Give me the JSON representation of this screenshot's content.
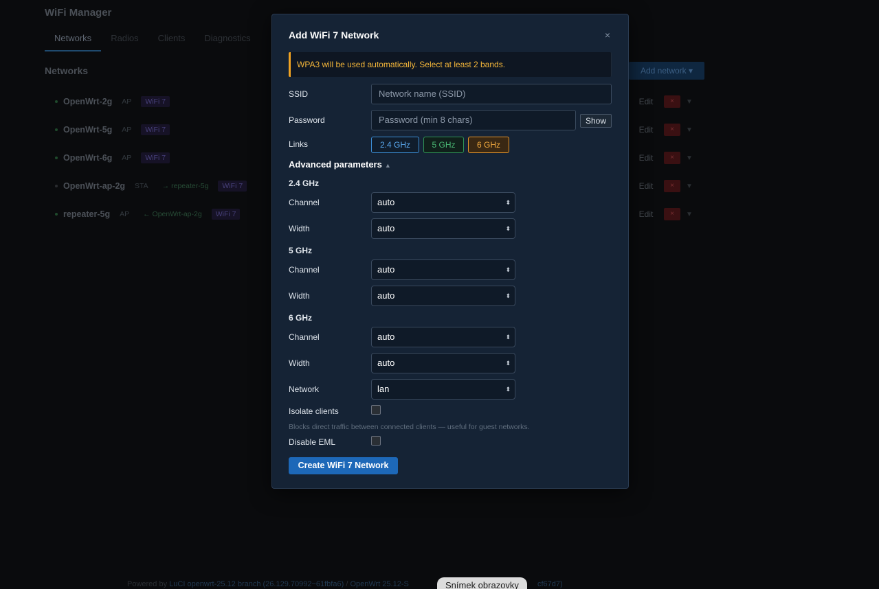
{
  "app": {
    "title": "WiFi Manager",
    "tabs": [
      {
        "label": "Networks"
      },
      {
        "label": "Radios"
      },
      {
        "label": "Clients"
      },
      {
        "label": "Diagnostics"
      }
    ],
    "section_title": "Networks",
    "add_network_label": "Add network ▾",
    "networks": [
      {
        "name": "OpenWrt-2g",
        "mode": "AP",
        "link": "",
        "standard": "WiFi 7",
        "edit": "Edit",
        "delete": "×",
        "caret": "▼"
      },
      {
        "name": "OpenWrt-5g",
        "mode": "AP",
        "link": "",
        "standard": "WiFi 7",
        "edit": "Edit",
        "delete": "×",
        "caret": "▼"
      },
      {
        "name": "OpenWrt-6g",
        "mode": "AP",
        "link": "",
        "standard": "WiFi 7",
        "edit": "Edit",
        "delete": "×",
        "caret": "▼"
      },
      {
        "name": "OpenWrt-ap-2g",
        "mode": "STA",
        "link": "→ repeater-5g",
        "standard": "WiFi 7",
        "edit": "Edit",
        "delete": "×",
        "caret": "▼"
      },
      {
        "name": "repeater-5g",
        "mode": "AP",
        "link": "← OpenWrt-ap-2g",
        "standard": "WiFi 7",
        "edit": "Edit",
        "delete": "×",
        "caret": "▼"
      }
    ],
    "footer": {
      "prefix": "Powered by ",
      "luci_link": "LuCI openwrt-25.12 branch (26.129.70992~61fbfa6)",
      "sep": " / ",
      "openwrt": "OpenWrt 25.12-S",
      "suffix_hidden": "cf67d7)"
    }
  },
  "toast": "Snímek obrazovky",
  "modal": {
    "title": "Add WiFi 7 Network",
    "close_icon": "×",
    "warning": "WPA3 will be used automatically. Select at least 2 bands.",
    "ssid": {
      "label": "SSID",
      "value": "",
      "placeholder": "Network name (SSID)"
    },
    "password": {
      "label": "Password",
      "value": "",
      "placeholder": "Password (min 8 chars)",
      "show_label": "Show"
    },
    "links": {
      "label": "Links",
      "bands": [
        {
          "label": "2.4 GHz",
          "selected": false,
          "color": "#3c8fd8"
        },
        {
          "label": "5 GHz",
          "selected": false,
          "color": "#2f9455"
        },
        {
          "label": "6 GHz",
          "selected": true,
          "color": "#e6952b"
        }
      ]
    },
    "advanced": {
      "label": "Advanced parameters",
      "toggle_icon": "▲"
    },
    "band_settings": [
      {
        "heading": "2.4 GHz",
        "channel_label": "Channel",
        "channel_value": "auto",
        "width_label": "Width",
        "width_value": "auto"
      },
      {
        "heading": "5 GHz",
        "channel_label": "Channel",
        "channel_value": "auto",
        "width_label": "Width",
        "width_value": "auto"
      },
      {
        "heading": "6 GHz",
        "channel_label": "Channel",
        "channel_value": "auto",
        "width_label": "Width",
        "width_value": "auto"
      }
    ],
    "network": {
      "label": "Network",
      "value": "lan"
    },
    "isolate": {
      "label": "Isolate clients",
      "checked": false,
      "hint": "Blocks direct traffic between connected clients — useful for guest networks."
    },
    "disable_eml": {
      "label": "Disable EML",
      "checked": false
    },
    "submit_label": "Create WiFi 7 Network",
    "chevron_icon": "⬍"
  },
  "colors": {
    "accent": "#1d68b8",
    "warning": "#f0a322",
    "modal_bg": "#152335",
    "page_bg": "#0a0b0d"
  }
}
